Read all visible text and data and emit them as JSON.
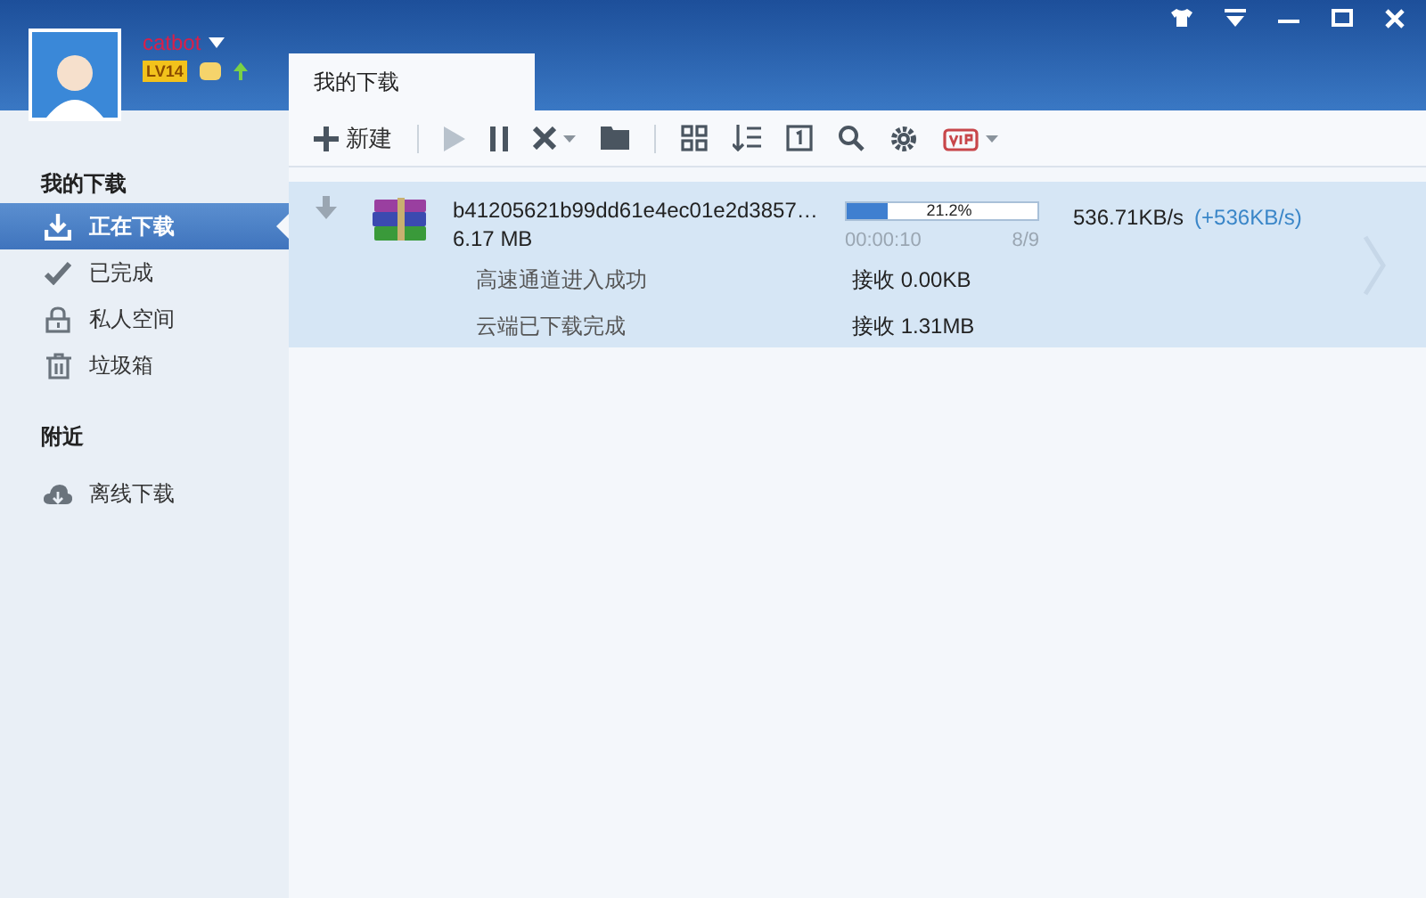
{
  "user": {
    "name": "catbot",
    "level_badge": "LV14"
  },
  "tabs": [
    {
      "label": "我的下载",
      "selected": true
    }
  ],
  "toolbar": {
    "new_label": "新建"
  },
  "sidebar": [
    {
      "heading": "我的下载",
      "items": [
        {
          "label": "正在下载",
          "kind": "downloading",
          "selected": true
        },
        {
          "label": "已完成",
          "kind": "done",
          "selected": false
        },
        {
          "label": "私人空间",
          "kind": "private",
          "selected": false
        },
        {
          "label": "垃圾箱",
          "kind": "trash",
          "selected": false
        }
      ]
    },
    {
      "heading": "附近",
      "items": [
        {
          "label": "离线下载",
          "kind": "offline",
          "selected": false
        }
      ]
    }
  ],
  "tasks": [
    {
      "name": "b41205621b99dd61e4ec01e2d3857…",
      "size": "6.17 MB",
      "level": 0.212,
      "percent": "21.2%",
      "elapsed": "00:00:10",
      "pieces": "8/9",
      "speed": "536.71KB/s",
      "boost": "(+536KB/s)",
      "selected": true,
      "channels": [
        {
          "label": "高速通道进入成功",
          "received": "接收 0.00KB"
        },
        {
          "label": "云端已下载完成",
          "received": "接收 1.31MB"
        }
      ]
    }
  ]
}
